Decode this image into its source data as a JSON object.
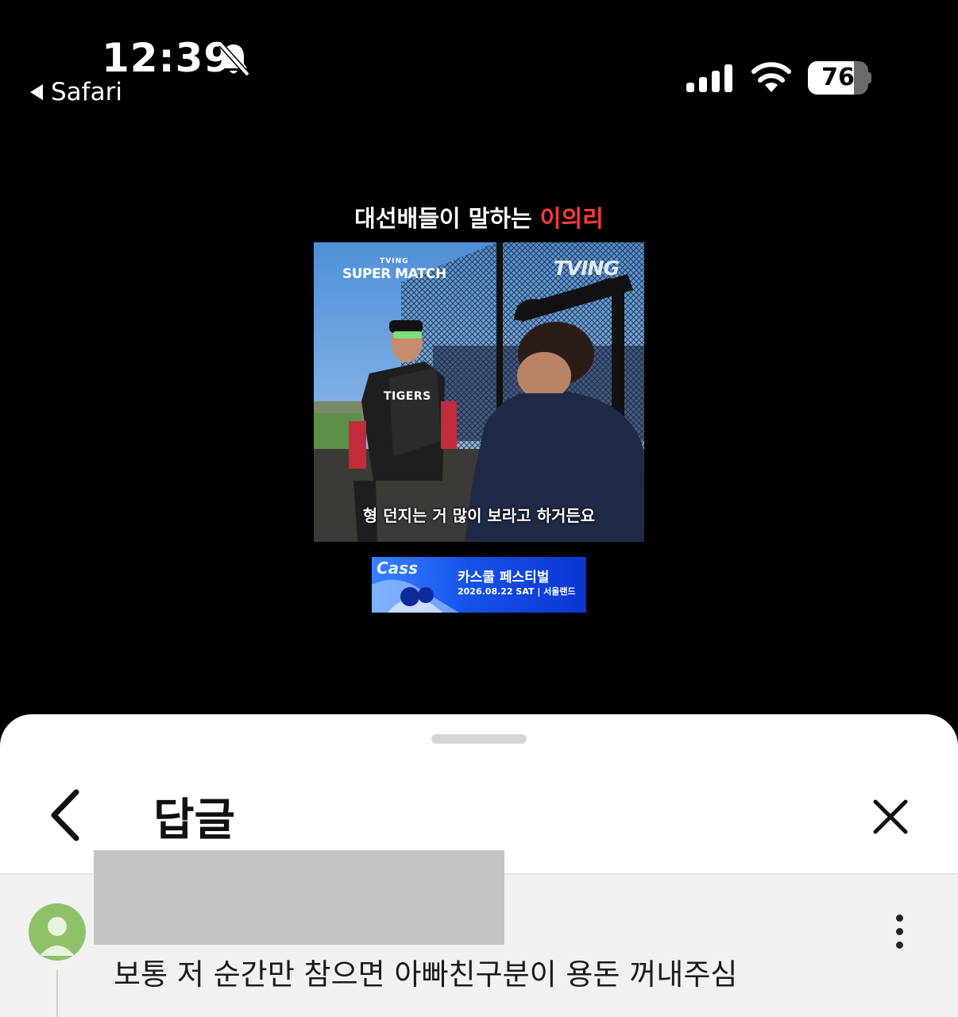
{
  "status_bar": {
    "time": "12:39",
    "back_app": "Safari",
    "battery_percent": "76",
    "battery_level": 0.76,
    "icons": [
      "bell-slash-icon",
      "cellular-signal-icon",
      "wifi-icon",
      "battery-icon"
    ]
  },
  "video": {
    "title_main": "대선배들이 말하는 ",
    "title_highlight": "이의리",
    "title_highlight_color": "#ff3b3b",
    "logo_left_small": "TVING",
    "logo_left_big": "SUPER MATCH",
    "logo_right": "TVING",
    "jersey": "TIGERS",
    "subtitle": "형 던지는 거 많이 보라고 하거든요"
  },
  "ad": {
    "brand": "Cass",
    "title": "카스쿨 페스티벌",
    "date": "2026.08.22 SAT | 서울랜드",
    "accent_color": "#1652ea"
  },
  "sheet": {
    "title": "답글",
    "back_icon": "chevron-left-icon",
    "close_icon": "close-icon",
    "comment": {
      "text": "보통 저 순간만 참으면 아빠친구분이 용돈 꺼내주심",
      "avatar_color": "#8fc06a",
      "more_icon": "more-vertical-icon"
    }
  }
}
